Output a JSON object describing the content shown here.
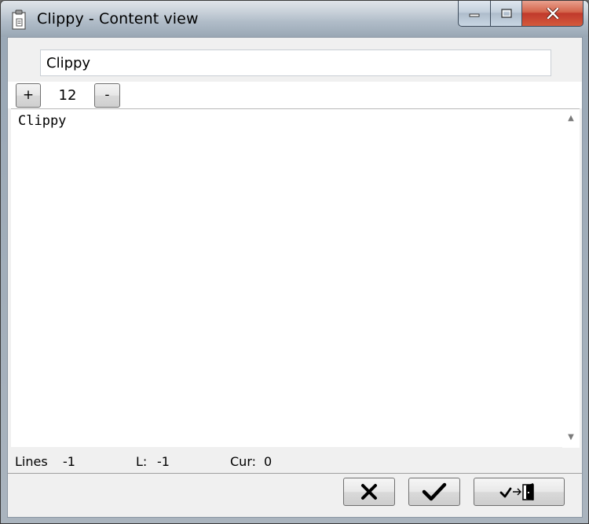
{
  "window": {
    "title": "Clippy - Content view",
    "icon": "clipboard-icon"
  },
  "caption_buttons": {
    "minimize": "minimize-icon",
    "maximize": "maximize-icon",
    "close": "close-icon"
  },
  "name_field": {
    "value": "Clippy"
  },
  "font_controls": {
    "increase_label": "+",
    "size_value": "12",
    "decrease_label": "-"
  },
  "editor": {
    "content": "Clippy"
  },
  "scrollbar": {
    "up_glyph": "▲",
    "down_glyph": "▼"
  },
  "status": {
    "lines_label": "Lines",
    "lines_value": "-1",
    "l_label": "L:",
    "l_value": "-1",
    "cur_label": "Cur:",
    "cur_value": "0"
  },
  "actions": {
    "cancel_icon": "cross-icon",
    "ok_icon": "check-icon",
    "ok_exit_icon": "check-exit-icon"
  }
}
